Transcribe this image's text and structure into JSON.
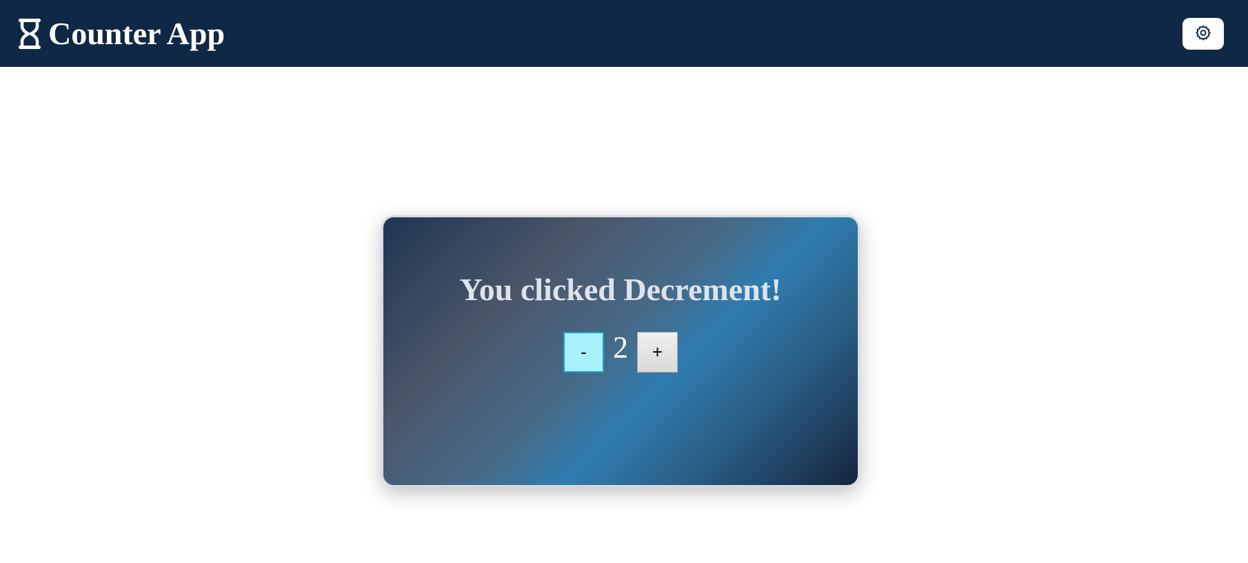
{
  "header": {
    "title": "Counter App",
    "logo_icon": "hourglass-icon",
    "settings_icon": "gear-icon",
    "background_color": "#0f2845"
  },
  "counter": {
    "message": "You clicked Decrement!",
    "decrement_label": "-",
    "increment_label": "+",
    "value": "2",
    "decrement_active_color": "#a8f1fb"
  }
}
